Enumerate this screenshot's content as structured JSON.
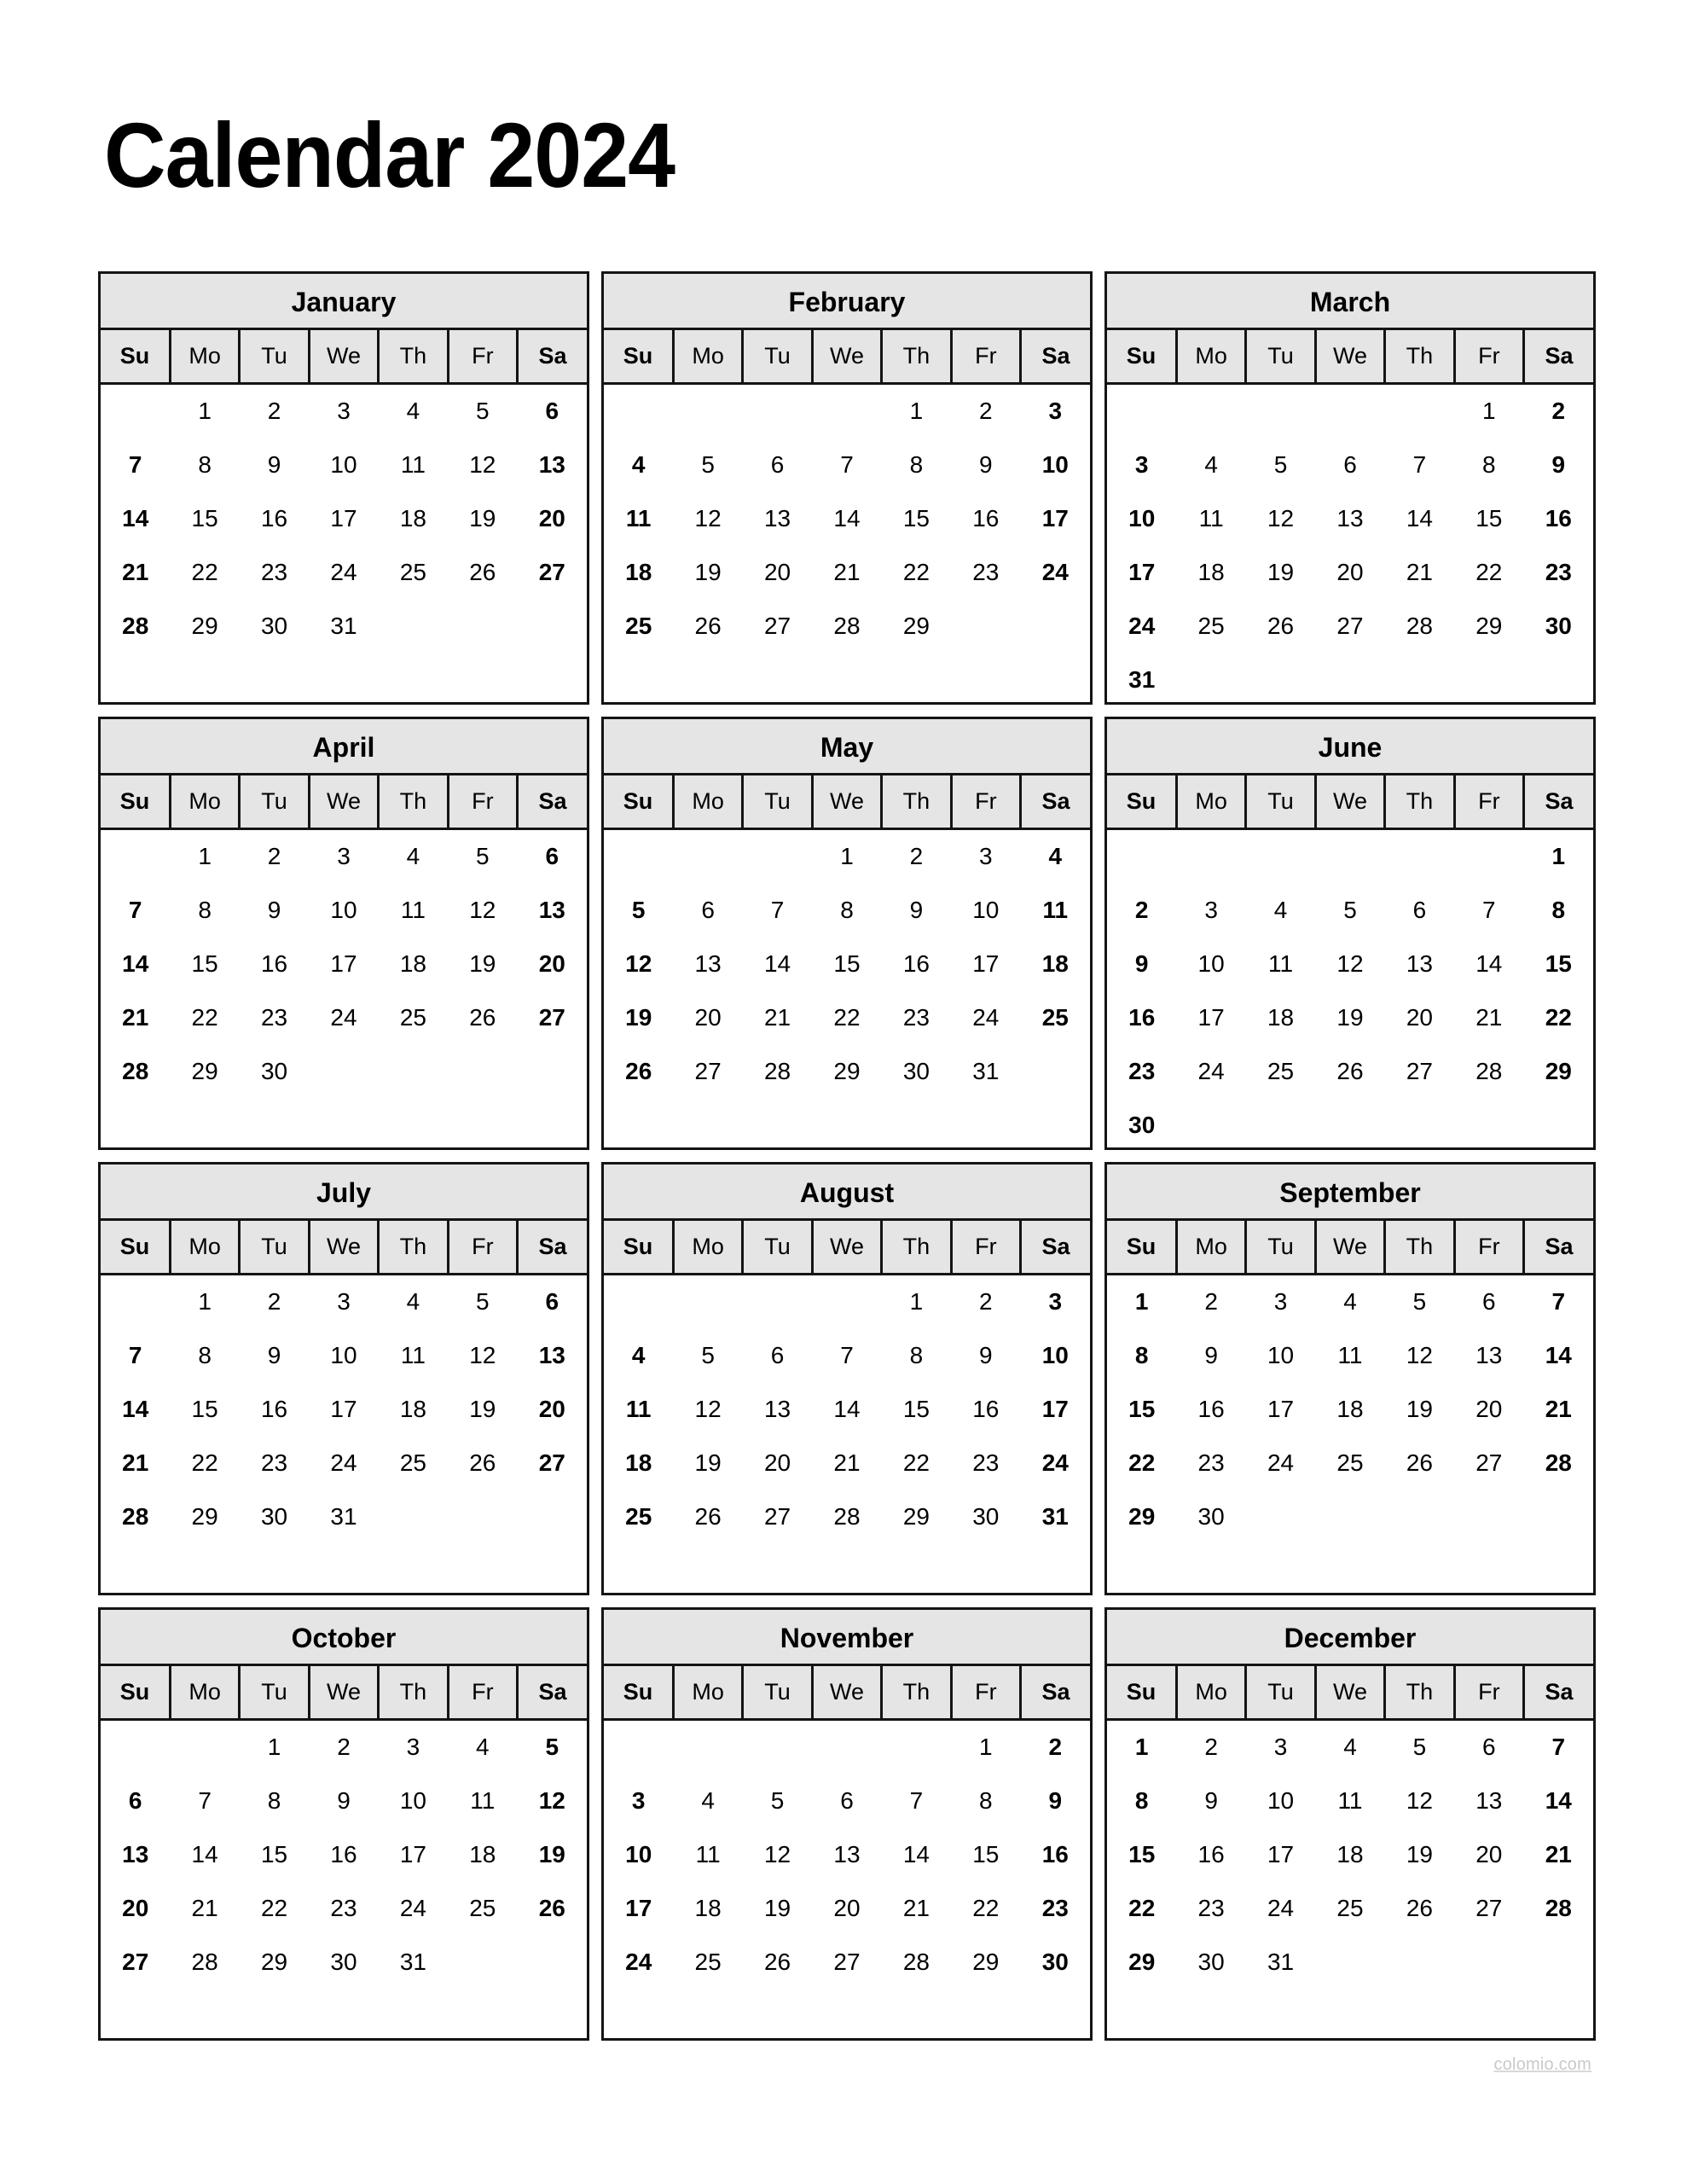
{
  "document": {
    "title": "Calendar 2024",
    "year": 2024,
    "watermark": "colomio.com"
  },
  "theme": {
    "page_background": "#ffffff",
    "header_background": "#e5e5e5",
    "border_color": "#141414",
    "text_color": "#000000",
    "watermark_color": "#c9c9c9"
  },
  "weekday_headers": [
    "Su",
    "Mo",
    "Tu",
    "We",
    "Th",
    "Fr",
    "Sa"
  ],
  "weekend_columns": [
    0,
    6
  ],
  "months": [
    {
      "name": "January",
      "index": 1,
      "first_weekday": 1,
      "days_in_month": 31,
      "weeks": [
        [
          "",
          "1",
          "2",
          "3",
          "4",
          "5",
          "6"
        ],
        [
          "7",
          "8",
          "9",
          "10",
          "11",
          "12",
          "13"
        ],
        [
          "14",
          "15",
          "16",
          "17",
          "18",
          "19",
          "20"
        ],
        [
          "21",
          "22",
          "23",
          "24",
          "25",
          "26",
          "27"
        ],
        [
          "28",
          "29",
          "30",
          "31",
          "",
          "",
          ""
        ],
        [
          "",
          "",
          "",
          "",
          "",
          "",
          ""
        ]
      ]
    },
    {
      "name": "February",
      "index": 2,
      "first_weekday": 4,
      "days_in_month": 29,
      "weeks": [
        [
          "",
          "",
          "",
          "",
          "1",
          "2",
          "3"
        ],
        [
          "4",
          "5",
          "6",
          "7",
          "8",
          "9",
          "10"
        ],
        [
          "11",
          "12",
          "13",
          "14",
          "15",
          "16",
          "17"
        ],
        [
          "18",
          "19",
          "20",
          "21",
          "22",
          "23",
          "24"
        ],
        [
          "25",
          "26",
          "27",
          "28",
          "29",
          "",
          ""
        ],
        [
          "",
          "",
          "",
          "",
          "",
          "",
          ""
        ]
      ]
    },
    {
      "name": "March",
      "index": 3,
      "first_weekday": 5,
      "days_in_month": 31,
      "weeks": [
        [
          "",
          "",
          "",
          "",
          "",
          "1",
          "2"
        ],
        [
          "3",
          "4",
          "5",
          "6",
          "7",
          "8",
          "9"
        ],
        [
          "10",
          "11",
          "12",
          "13",
          "14",
          "15",
          "16"
        ],
        [
          "17",
          "18",
          "19",
          "20",
          "21",
          "22",
          "23"
        ],
        [
          "24",
          "25",
          "26",
          "27",
          "28",
          "29",
          "30"
        ],
        [
          "31",
          "",
          "",
          "",
          "",
          "",
          ""
        ]
      ]
    },
    {
      "name": "April",
      "index": 4,
      "first_weekday": 1,
      "days_in_month": 30,
      "weeks": [
        [
          "",
          "1",
          "2",
          "3",
          "4",
          "5",
          "6"
        ],
        [
          "7",
          "8",
          "9",
          "10",
          "11",
          "12",
          "13"
        ],
        [
          "14",
          "15",
          "16",
          "17",
          "18",
          "19",
          "20"
        ],
        [
          "21",
          "22",
          "23",
          "24",
          "25",
          "26",
          "27"
        ],
        [
          "28",
          "29",
          "30",
          "",
          "",
          "",
          ""
        ],
        [
          "",
          "",
          "",
          "",
          "",
          "",
          ""
        ]
      ]
    },
    {
      "name": "May",
      "index": 5,
      "first_weekday": 3,
      "days_in_month": 31,
      "weeks": [
        [
          "",
          "",
          "",
          "1",
          "2",
          "3",
          "4"
        ],
        [
          "5",
          "6",
          "7",
          "8",
          "9",
          "10",
          "11"
        ],
        [
          "12",
          "13",
          "14",
          "15",
          "16",
          "17",
          "18"
        ],
        [
          "19",
          "20",
          "21",
          "22",
          "23",
          "24",
          "25"
        ],
        [
          "26",
          "27",
          "28",
          "29",
          "30",
          "31",
          ""
        ],
        [
          "",
          "",
          "",
          "",
          "",
          "",
          ""
        ]
      ]
    },
    {
      "name": "June",
      "index": 6,
      "first_weekday": 6,
      "days_in_month": 30,
      "weeks": [
        [
          "",
          "",
          "",
          "",
          "",
          "",
          "1"
        ],
        [
          "2",
          "3",
          "4",
          "5",
          "6",
          "7",
          "8"
        ],
        [
          "9",
          "10",
          "11",
          "12",
          "13",
          "14",
          "15"
        ],
        [
          "16",
          "17",
          "18",
          "19",
          "20",
          "21",
          "22"
        ],
        [
          "23",
          "24",
          "25",
          "26",
          "27",
          "28",
          "29"
        ],
        [
          "30",
          "",
          "",
          "",
          "",
          "",
          ""
        ]
      ]
    },
    {
      "name": "July",
      "index": 7,
      "first_weekday": 1,
      "days_in_month": 31,
      "weeks": [
        [
          "",
          "1",
          "2",
          "3",
          "4",
          "5",
          "6"
        ],
        [
          "7",
          "8",
          "9",
          "10",
          "11",
          "12",
          "13"
        ],
        [
          "14",
          "15",
          "16",
          "17",
          "18",
          "19",
          "20"
        ],
        [
          "21",
          "22",
          "23",
          "24",
          "25",
          "26",
          "27"
        ],
        [
          "28",
          "29",
          "30",
          "31",
          "",
          "",
          ""
        ],
        [
          "",
          "",
          "",
          "",
          "",
          "",
          ""
        ]
      ]
    },
    {
      "name": "August",
      "index": 8,
      "first_weekday": 4,
      "days_in_month": 31,
      "weeks": [
        [
          "",
          "",
          "",
          "",
          "1",
          "2",
          "3"
        ],
        [
          "4",
          "5",
          "6",
          "7",
          "8",
          "9",
          "10"
        ],
        [
          "11",
          "12",
          "13",
          "14",
          "15",
          "16",
          "17"
        ],
        [
          "18",
          "19",
          "20",
          "21",
          "22",
          "23",
          "24"
        ],
        [
          "25",
          "26",
          "27",
          "28",
          "29",
          "30",
          "31"
        ],
        [
          "",
          "",
          "",
          "",
          "",
          "",
          ""
        ]
      ]
    },
    {
      "name": "September",
      "index": 9,
      "first_weekday": 0,
      "days_in_month": 30,
      "weeks": [
        [
          "1",
          "2",
          "3",
          "4",
          "5",
          "6",
          "7"
        ],
        [
          "8",
          "9",
          "10",
          "11",
          "12",
          "13",
          "14"
        ],
        [
          "15",
          "16",
          "17",
          "18",
          "19",
          "20",
          "21"
        ],
        [
          "22",
          "23",
          "24",
          "25",
          "26",
          "27",
          "28"
        ],
        [
          "29",
          "30",
          "",
          "",
          "",
          "",
          ""
        ],
        [
          "",
          "",
          "",
          "",
          "",
          "",
          ""
        ]
      ]
    },
    {
      "name": "October",
      "index": 10,
      "first_weekday": 2,
      "days_in_month": 31,
      "weeks": [
        [
          "",
          "",
          "1",
          "2",
          "3",
          "4",
          "5"
        ],
        [
          "6",
          "7",
          "8",
          "9",
          "10",
          "11",
          "12"
        ],
        [
          "13",
          "14",
          "15",
          "16",
          "17",
          "18",
          "19"
        ],
        [
          "20",
          "21",
          "22",
          "23",
          "24",
          "25",
          "26"
        ],
        [
          "27",
          "28",
          "29",
          "30",
          "31",
          "",
          ""
        ],
        [
          "",
          "",
          "",
          "",
          "",
          "",
          ""
        ]
      ]
    },
    {
      "name": "November",
      "index": 11,
      "first_weekday": 5,
      "days_in_month": 30,
      "weeks": [
        [
          "",
          "",
          "",
          "",
          "",
          "1",
          "2"
        ],
        [
          "3",
          "4",
          "5",
          "6",
          "7",
          "8",
          "9"
        ],
        [
          "10",
          "11",
          "12",
          "13",
          "14",
          "15",
          "16"
        ],
        [
          "17",
          "18",
          "19",
          "20",
          "21",
          "22",
          "23"
        ],
        [
          "24",
          "25",
          "26",
          "27",
          "28",
          "29",
          "30"
        ],
        [
          "",
          "",
          "",
          "",
          "",
          "",
          ""
        ]
      ]
    },
    {
      "name": "December",
      "index": 12,
      "first_weekday": 0,
      "days_in_month": 31,
      "weeks": [
        [
          "1",
          "2",
          "3",
          "4",
          "5",
          "6",
          "7"
        ],
        [
          "8",
          "9",
          "10",
          "11",
          "12",
          "13",
          "14"
        ],
        [
          "15",
          "16",
          "17",
          "18",
          "19",
          "20",
          "21"
        ],
        [
          "22",
          "23",
          "24",
          "25",
          "26",
          "27",
          "28"
        ],
        [
          "29",
          "30",
          "31",
          "",
          "",
          "",
          ""
        ],
        [
          "",
          "",
          "",
          "",
          "",
          "",
          ""
        ]
      ]
    }
  ]
}
